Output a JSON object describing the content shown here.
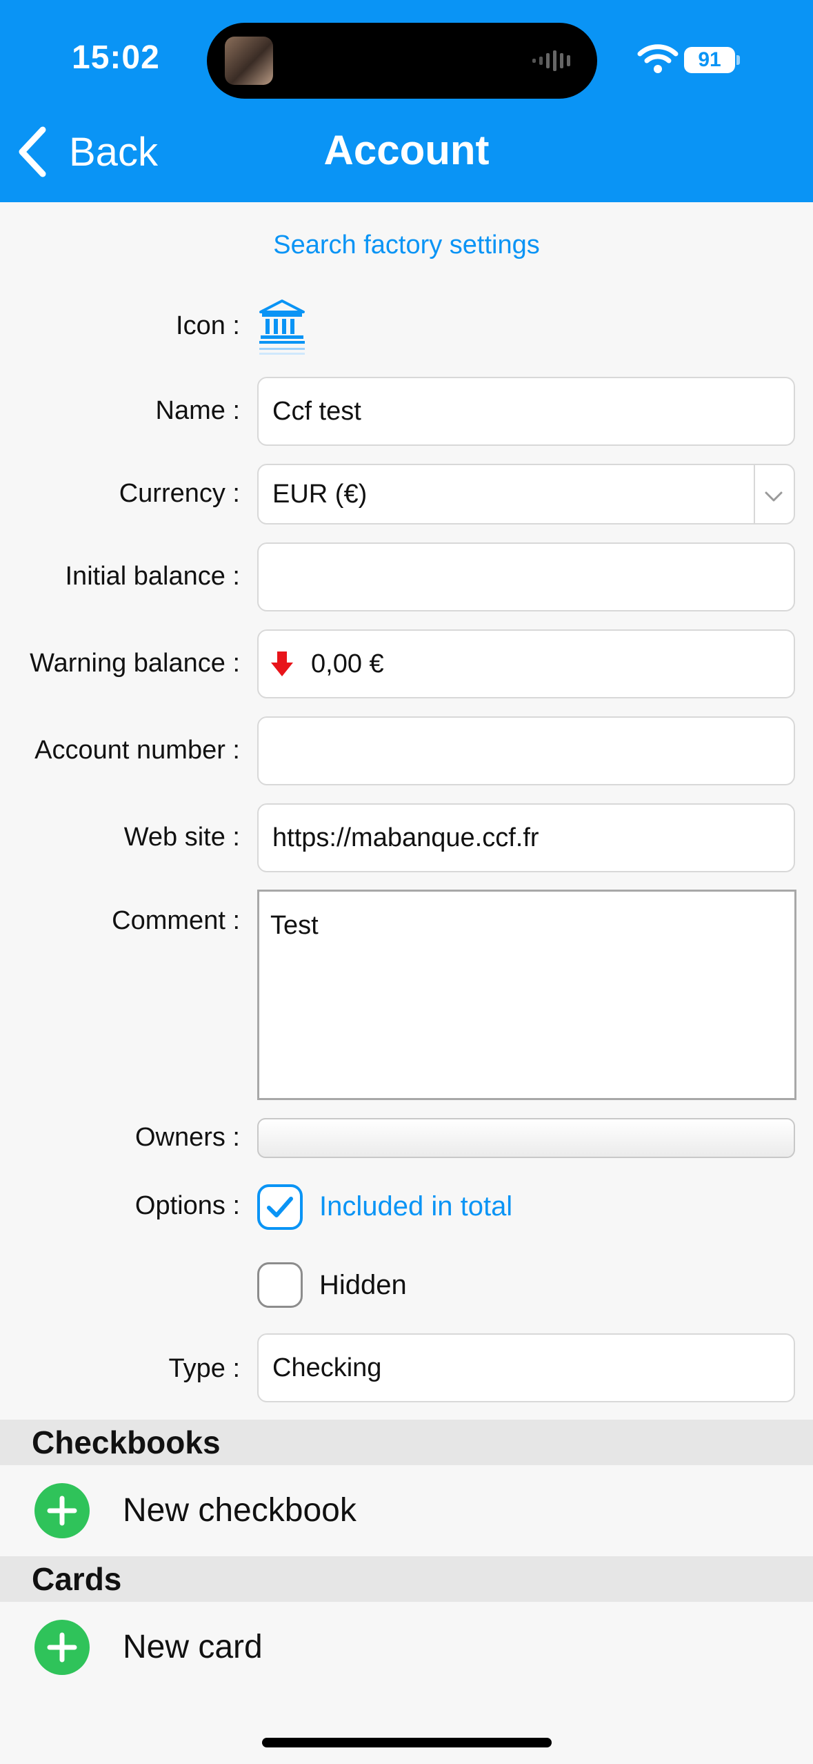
{
  "status": {
    "time": "15:02",
    "battery": "91"
  },
  "nav": {
    "back_label": "Back",
    "title": "Account"
  },
  "factory_link": "Search factory settings",
  "form": {
    "icon_label": "Icon :",
    "name_label": "Name :",
    "name_value": "Ccf test",
    "currency_label": "Currency :",
    "currency_value": "EUR (€)",
    "initial_balance_label": "Initial balance :",
    "initial_balance_value": "",
    "warning_balance_label": "Warning balance :",
    "warning_balance_value": "0,00 €",
    "account_number_label": "Account number :",
    "account_number_value": "",
    "website_label": "Web site :",
    "website_value": "https://mabanque.ccf.fr",
    "comment_label": "Comment :",
    "comment_value": "Test",
    "owners_label": "Owners :",
    "options_label": "Options :",
    "option_included": "Included in total",
    "option_included_checked": true,
    "option_hidden": "Hidden",
    "option_hidden_checked": false,
    "type_label": "Type :",
    "type_value": "Checking"
  },
  "sections": {
    "checkbooks_title": "Checkbooks",
    "new_checkbook": "New checkbook",
    "cards_title": "Cards",
    "new_card": "New card"
  },
  "colors": {
    "accent": "#0a94f5",
    "add": "#2fc35a",
    "warning_arrow": "#e8141a"
  }
}
